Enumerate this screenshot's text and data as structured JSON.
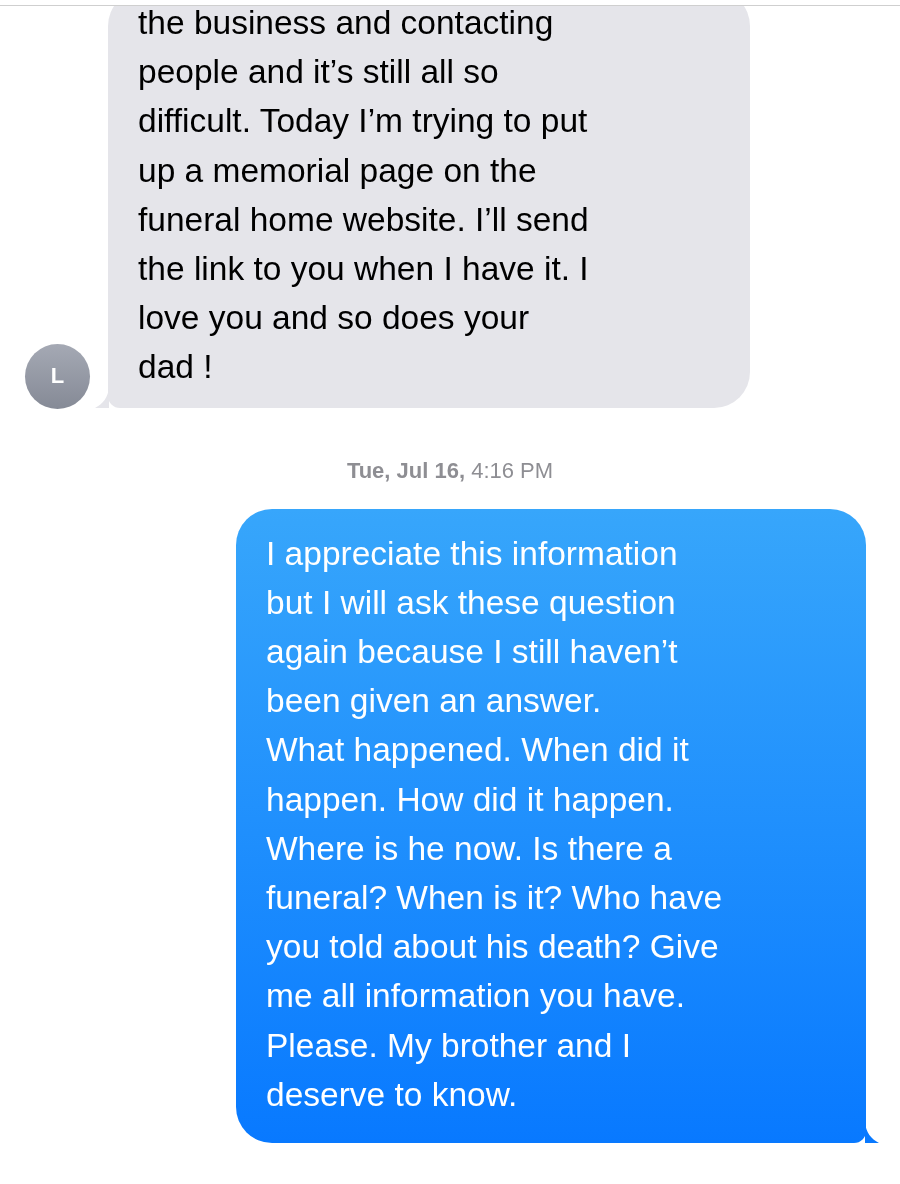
{
  "messages": [
    {
      "kind": "received",
      "sender_initial": "L",
      "lines": [
        "the business and contacting",
        "people and it’s still all so",
        "difficult. Today I’m trying to put",
        "up a memorial page on the",
        "funeral home website. I’ll send",
        "the link to you when I have it. I",
        "love you and so does your",
        "dad !"
      ]
    },
    {
      "kind": "timestamp",
      "text": "**Tue, Jul 16,** 4:16 PM"
    },
    {
      "kind": "sent",
      "lines": [
        "I appreciate this information",
        "but I will ask these question",
        "again because I still haven’t",
        "been given an answer.",
        "What happened. When did it",
        "happen. How did it happen.",
        "Where is he now. Is there a",
        "funeral? When is it? Who have",
        "you told about his death? Give",
        "me all information you have.",
        "Please. My brother and I",
        "deserve to know."
      ]
    }
  ]
}
